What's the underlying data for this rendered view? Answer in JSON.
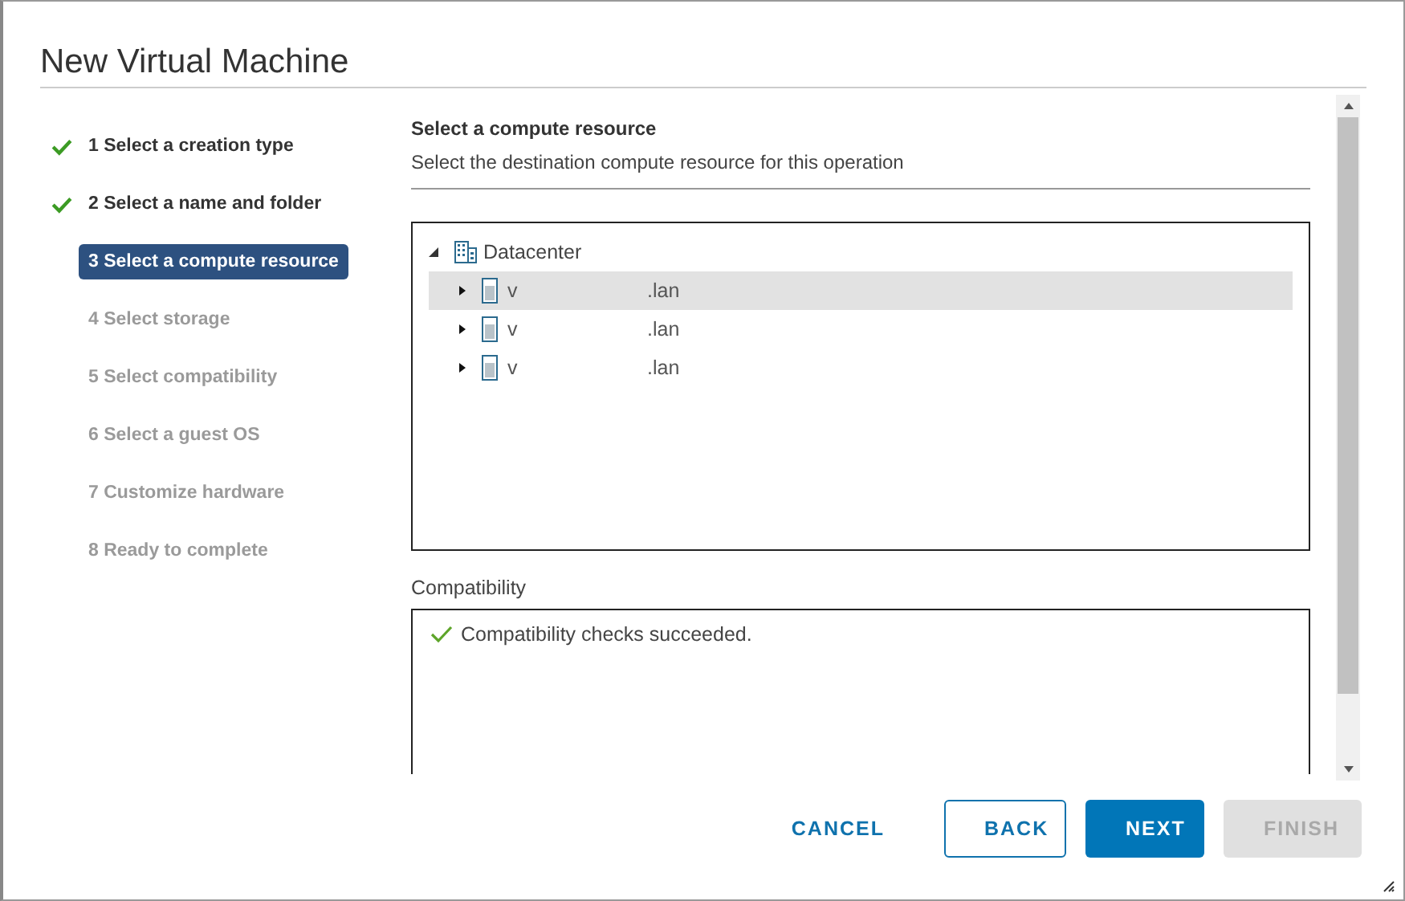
{
  "window": {
    "title": "New Virtual Machine"
  },
  "steps": [
    {
      "label": "1 Select a creation type",
      "done": true,
      "selected": false,
      "disabled": false
    },
    {
      "label": "2 Select a name and folder",
      "done": true,
      "selected": false,
      "disabled": false
    },
    {
      "label": "3 Select a compute resource",
      "done": false,
      "selected": true,
      "disabled": false
    },
    {
      "label": "4 Select storage",
      "done": false,
      "selected": false,
      "disabled": true
    },
    {
      "label": "5 Select compatibility",
      "done": false,
      "selected": false,
      "disabled": true
    },
    {
      "label": "6 Select a guest OS",
      "done": false,
      "selected": false,
      "disabled": true
    },
    {
      "label": "7 Customize hardware",
      "done": false,
      "selected": false,
      "disabled": true
    },
    {
      "label": "8 Ready to complete",
      "done": false,
      "selected": false,
      "disabled": true
    }
  ],
  "section": {
    "title": "Select a compute resource",
    "subtitle": "Select the destination compute resource for this operation"
  },
  "tree": {
    "label": "Datacenter",
    "expanded": true,
    "children": [
      {
        "prefix": "v",
        "suffix": ".lan",
        "expanded": false,
        "selected": true
      },
      {
        "prefix": "v",
        "suffix": ".lan",
        "expanded": false,
        "selected": false
      },
      {
        "prefix": "v",
        "suffix": ".lan",
        "expanded": false,
        "selected": false
      }
    ]
  },
  "compatibility": {
    "label": "Compatibility",
    "message": "Compatibility checks succeeded."
  },
  "buttons": [
    {
      "label": "CANCEL",
      "kind": "link",
      "disabled": false
    },
    {
      "label": "BACK",
      "kind": "outline",
      "disabled": false
    },
    {
      "label": "NEXT",
      "kind": "primary",
      "disabled": false
    },
    {
      "label": "FINISH",
      "kind": "primary",
      "disabled": true
    }
  ]
}
